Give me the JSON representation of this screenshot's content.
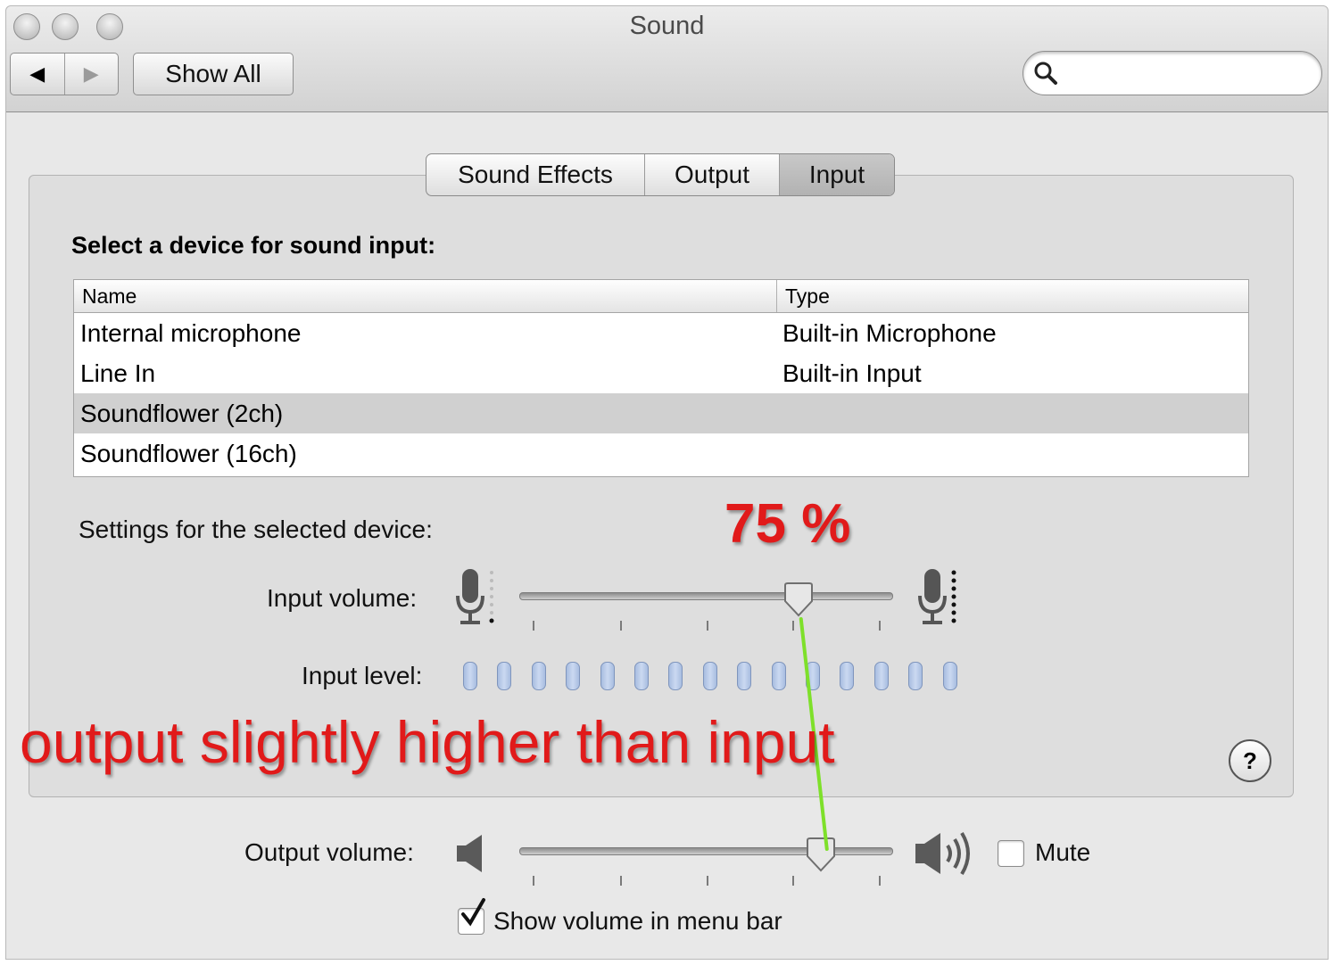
{
  "window": {
    "title": "Sound"
  },
  "toolbar": {
    "back_glyph": "◀",
    "forward_glyph": "▶",
    "show_all_label": "Show All",
    "search_value": ""
  },
  "tabs": [
    {
      "label": "Sound Effects",
      "selected": false
    },
    {
      "label": "Output",
      "selected": false
    },
    {
      "label": "Input",
      "selected": true
    }
  ],
  "input_section": {
    "heading": "Select a device for sound input:",
    "columns": [
      "Name",
      "Type"
    ],
    "rows": [
      {
        "name": "Internal microphone",
        "type": "Built-in Microphone",
        "selected": false
      },
      {
        "name": "Line In",
        "type": "Built-in Input",
        "selected": false
      },
      {
        "name": "Soundflower (2ch)",
        "type": "",
        "selected": true
      },
      {
        "name": "Soundflower (16ch)",
        "type": "",
        "selected": false
      }
    ]
  },
  "settings": {
    "heading": "Settings for the selected device:",
    "input_volume_label": "Input volume:",
    "input_volume_value": 0.75,
    "input_level_label": "Input level:",
    "input_level_segments": 15,
    "input_level_active": 0
  },
  "output": {
    "output_volume_label": "Output volume:",
    "output_volume_value": 0.81,
    "mute_label": "Mute",
    "mute_checked": false,
    "show_volume_label": "Show volume in menu bar",
    "show_volume_checked": true
  },
  "help": {
    "glyph": "?"
  },
  "annotations": {
    "percent_text": "75 %",
    "note_text": "output slightly higher than input",
    "line_color": "#7ee02a",
    "text_color": "#e11a1a"
  },
  "icons": {
    "search": "search-icon",
    "mic_low": "microphone-low-icon",
    "mic_high": "microphone-high-icon",
    "speaker_low": "speaker-low-icon",
    "speaker_high": "speaker-high-icon",
    "help": "help-icon"
  }
}
